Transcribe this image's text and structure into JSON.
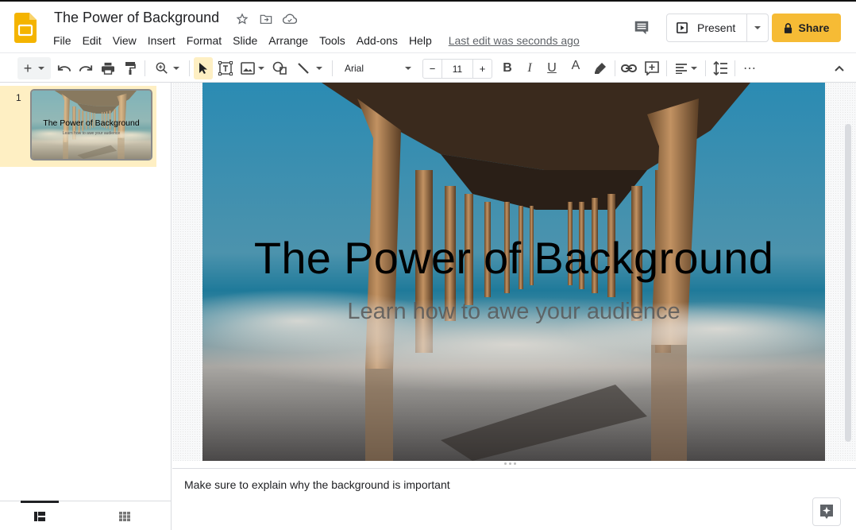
{
  "app": {
    "doc_title": "The Power of Background",
    "title_icons": [
      "star-icon",
      "move-to-folder-icon",
      "cloud-saved-icon"
    ],
    "menu": [
      "File",
      "Edit",
      "View",
      "Insert",
      "Format",
      "Slide",
      "Arrange",
      "Tools",
      "Add-ons",
      "Help"
    ],
    "last_edit": "Last edit was seconds ago",
    "present_label": "Present",
    "share_label": "Share",
    "accent_color": "#f6bb35"
  },
  "toolbar": {
    "font_name": "Arial",
    "font_size": "11",
    "minus": "−",
    "plus": "+",
    "bold": "B",
    "italic": "I",
    "underline": "U",
    "text_color_glyph": "A",
    "more": "⋯"
  },
  "filmstrip": {
    "slides": [
      {
        "number": "1",
        "title": "The Power of Background",
        "subtitle": "Learn how to awe your audience",
        "selected": true
      }
    ]
  },
  "slide": {
    "title": "The Power of Background",
    "subtitle": "Learn how to awe your audience"
  },
  "notes": {
    "text": "Make sure to explain why the background is important"
  }
}
